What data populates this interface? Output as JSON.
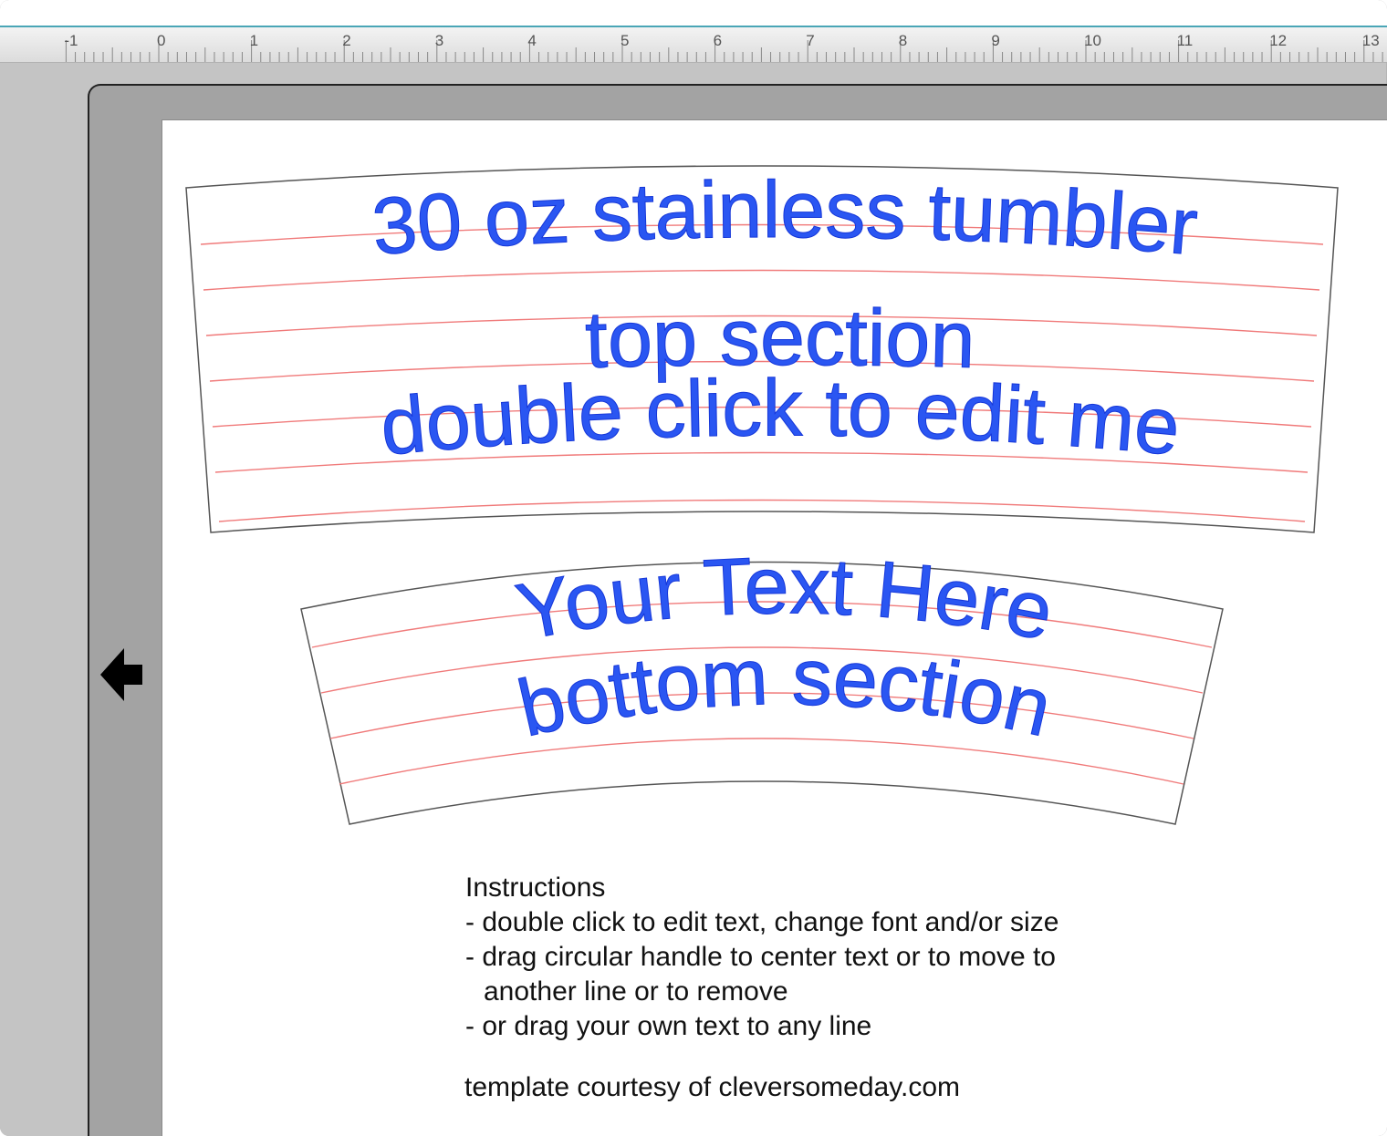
{
  "ruler": {
    "labels": [
      "-1",
      "0",
      "1",
      "2",
      "3",
      "4",
      "5",
      "6",
      "7",
      "8",
      "9",
      "10",
      "11",
      "12",
      "13"
    ]
  },
  "template": {
    "top_section": {
      "line1": "30 oz stainless tumbler",
      "line2": "top section",
      "line3": "double click to edit me"
    },
    "bottom_section": {
      "line1": "Your Text Here",
      "line2": "bottom section"
    }
  },
  "instructions": {
    "heading": "Instructions",
    "item1": "- double click to edit text, change font and/or size",
    "item2": "- drag circular handle to center text or to move to",
    "item2_cont": "another line or to remove",
    "item3": "- or drag your own text to any line"
  },
  "credit": "template courtesy of cleversomeday.com",
  "colors": {
    "template_text": "#2a56f2",
    "guide_lines": "#f07a7a",
    "outline": "#555555",
    "mat": "#a3a3a3"
  },
  "icons": {
    "nav": "arrow-left-icon"
  }
}
